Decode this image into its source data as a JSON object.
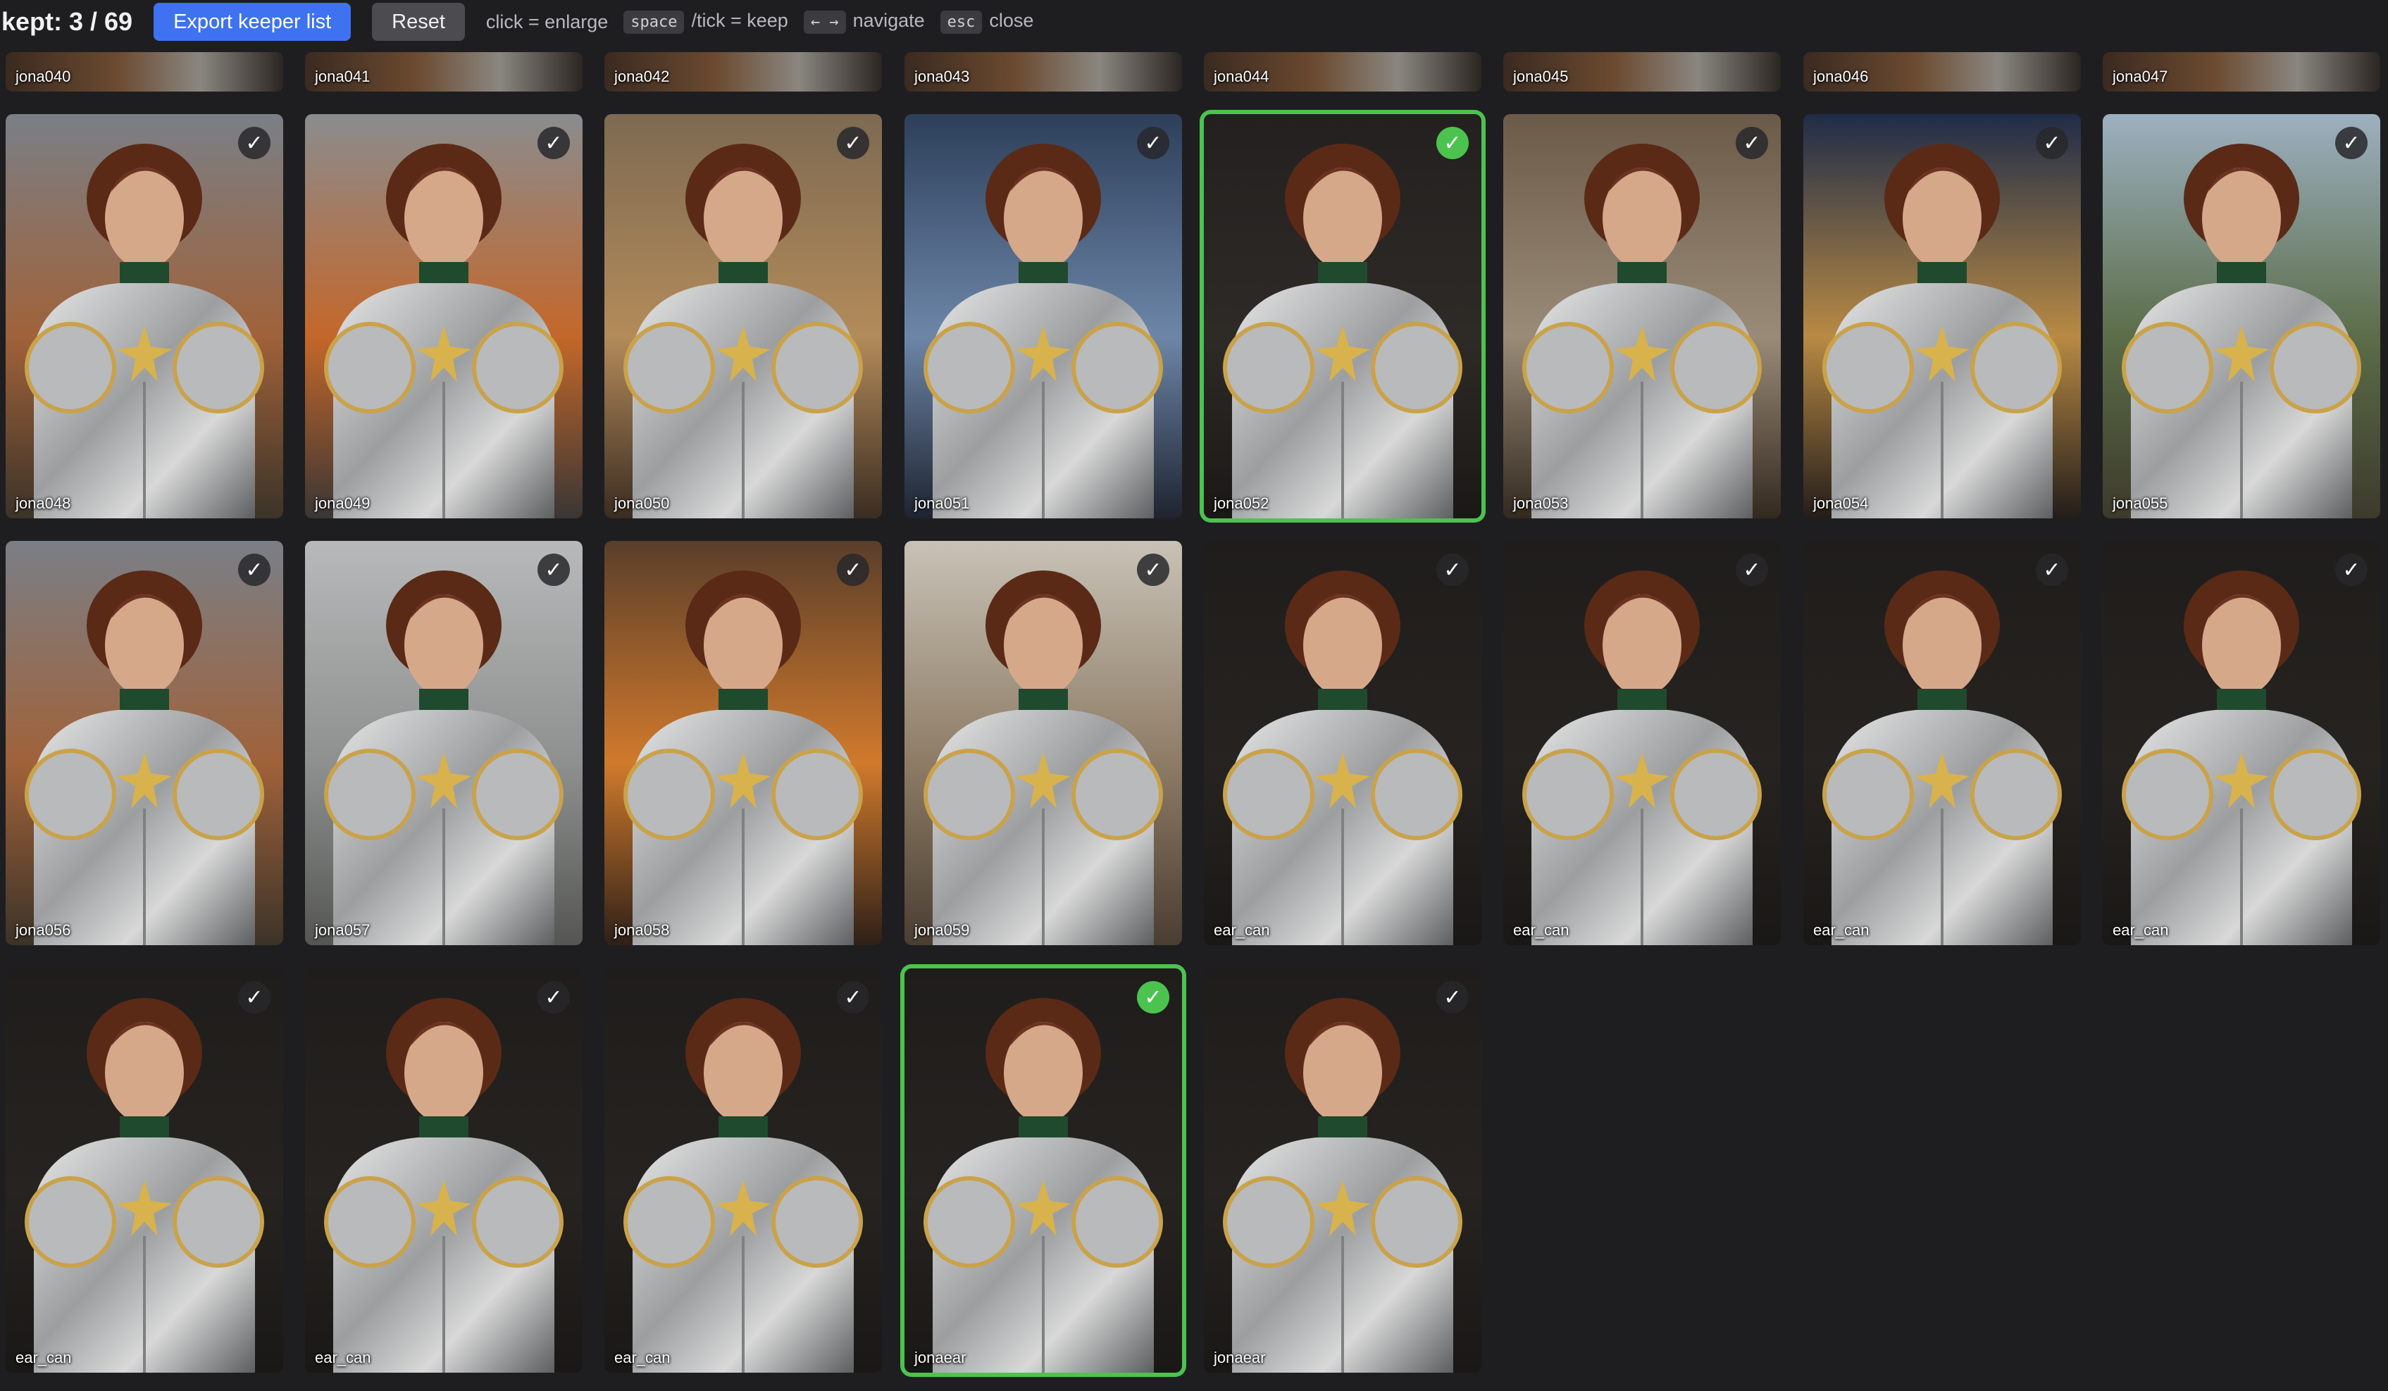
{
  "toolbar": {
    "kept_label": "kept: 3 / 69",
    "export_label": "Export keeper list",
    "reset_label": "Reset",
    "hint_click": "click = enlarge",
    "key_space": "space",
    "hint_tick": "/tick = keep",
    "key_arrows": "← →",
    "hint_navigate": "navigate",
    "key_esc": "esc",
    "hint_close": "close"
  },
  "check_glyph": "✓",
  "colors": {
    "background": "#1e1e21",
    "accent_blue": "#3f72f0",
    "kept_green": "#4cc34f"
  },
  "tiles_partial": [
    {
      "label": "jona040"
    },
    {
      "label": "jona041"
    },
    {
      "label": "jona042"
    },
    {
      "label": "jona043"
    },
    {
      "label": "jona044"
    },
    {
      "label": "jona045"
    },
    {
      "label": "jona046"
    },
    {
      "label": "jona047"
    }
  ],
  "tiles": [
    {
      "label": "jona048",
      "kept": false,
      "bg": "autumn-forest"
    },
    {
      "label": "jona049",
      "kept": false,
      "bg": "ruins-fire"
    },
    {
      "label": "jona050",
      "kept": false,
      "bg": "tavern"
    },
    {
      "label": "jona051",
      "kept": false,
      "bg": "night-moon"
    },
    {
      "label": "jona052",
      "kept": true,
      "bg": "dark-candle"
    },
    {
      "label": "jona053",
      "kept": false,
      "bg": "library-town"
    },
    {
      "label": "jona054",
      "kept": false,
      "bg": "night-camp"
    },
    {
      "label": "jona055",
      "kept": false,
      "bg": "pine-forest"
    },
    {
      "label": "jona056",
      "kept": false,
      "bg": "autumn-forest"
    },
    {
      "label": "jona057",
      "kept": false,
      "bg": "ruins-fog"
    },
    {
      "label": "jona058",
      "kept": false,
      "bg": "tavern-fire"
    },
    {
      "label": "jona059",
      "kept": false,
      "bg": "window-hall"
    },
    {
      "label": "ear_can",
      "kept": false,
      "bg": "dark"
    },
    {
      "label": "ear_can",
      "kept": false,
      "bg": "dark"
    },
    {
      "label": "ear_can",
      "kept": false,
      "bg": "dark"
    },
    {
      "label": "ear_can",
      "kept": false,
      "bg": "dark"
    },
    {
      "label": "ear_can",
      "kept": false,
      "bg": "dark"
    },
    {
      "label": "ear_can",
      "kept": false,
      "bg": "dark"
    },
    {
      "label": "ear_can",
      "kept": false,
      "bg": "dark"
    },
    {
      "label": "jonaear",
      "kept": true,
      "bg": "dark"
    },
    {
      "label": "jonaear",
      "kept": false,
      "bg": "dark"
    }
  ]
}
